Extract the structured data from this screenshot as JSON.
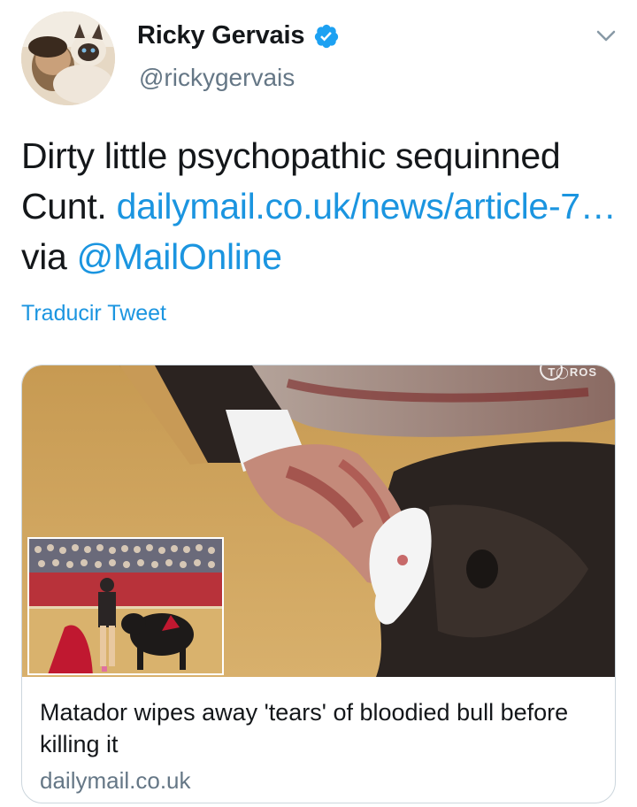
{
  "header": {
    "display_name": "Ricky Gervais",
    "handle": "@rickygervais",
    "verified": true,
    "avatar_icon": "avatar-photo",
    "menu_icon": "chevron-down-icon"
  },
  "tweet": {
    "text_part1": "Dirty little psychopathic sequinned Cunt. ",
    "link_text": "dailymail.co.uk/news/article-7…",
    "text_part2": " via ",
    "mention": "@MailOnline",
    "translate_label": "Traducir Tweet"
  },
  "card": {
    "broadcaster_logo": "T◯ROS",
    "title": "Matador wipes away 'tears' of bloodied bull before killing it",
    "domain": "dailymail.co.uk"
  },
  "colors": {
    "link": "#1b95e0",
    "text": "#14171a",
    "secondary": "#657786",
    "border": "#ccd6dd",
    "verified": "#1da1f2"
  }
}
